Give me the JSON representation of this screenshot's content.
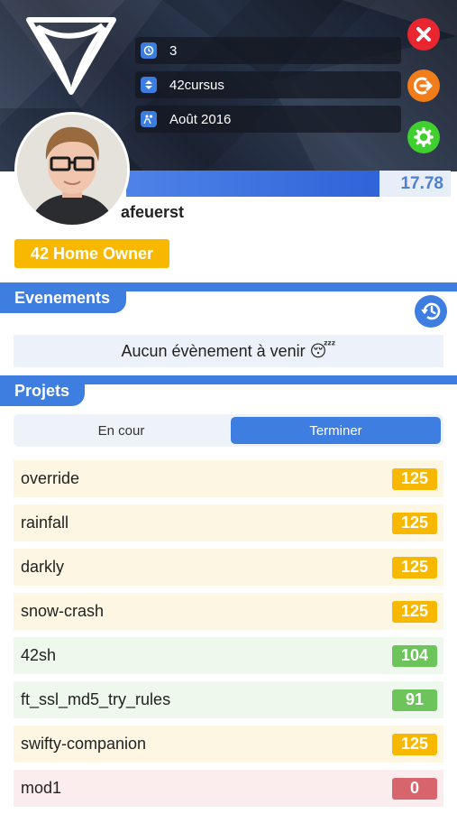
{
  "header": {
    "info": [
      {
        "icon": "level-icon",
        "text": "3"
      },
      {
        "icon": "sort-icon",
        "text": "42cursus"
      },
      {
        "icon": "pool-icon",
        "text": "Août 2016"
      }
    ]
  },
  "user": {
    "login": "afeuerst",
    "level_text": "17.78",
    "level_progress": 0.78,
    "title_badge": "42 Home Owner"
  },
  "events": {
    "title": "Evenements",
    "empty_text": "Aucun évènement à venir 😴"
  },
  "projects": {
    "title": "Projets",
    "segments": [
      "En cour",
      "Terminer"
    ],
    "active_segment": 1,
    "items": [
      {
        "name": "override",
        "mark": "125",
        "status": "success-bonus"
      },
      {
        "name": "rainfall",
        "mark": "125",
        "status": "success-bonus"
      },
      {
        "name": "darkly",
        "mark": "125",
        "status": "success-bonus"
      },
      {
        "name": "snow-crash",
        "mark": "125",
        "status": "success-bonus"
      },
      {
        "name": "42sh",
        "mark": "104",
        "status": "success"
      },
      {
        "name": "ft_ssl_md5_try_rules",
        "mark": "91",
        "status": "success"
      },
      {
        "name": "swifty-companion",
        "mark": "125",
        "status": "success-bonus"
      },
      {
        "name": "mod1",
        "mark": "0",
        "status": "fail"
      }
    ]
  },
  "colors": {
    "accent": "#3d7ee0",
    "bonus_bg": "#fdf6e3",
    "bonus_badge": "#f8b800",
    "success_bg": "#eef8ec",
    "success_badge": "#6cc45a",
    "fail_bg": "#fbecee",
    "fail_badge": "#d8646e"
  }
}
